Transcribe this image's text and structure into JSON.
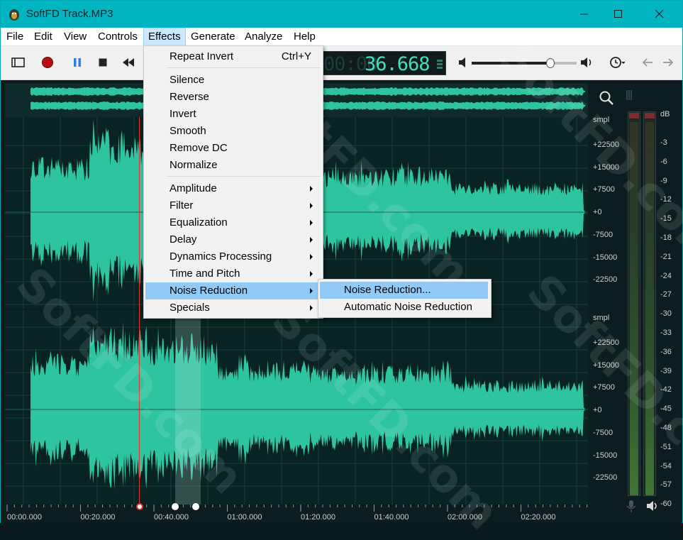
{
  "window": {
    "title": "SoftFD Track.MP3"
  },
  "menubar": [
    "File",
    "Edit",
    "View",
    "Controls",
    "Effects",
    "Generate",
    "Analyze",
    "Help"
  ],
  "effects_menu": {
    "items": [
      {
        "label": "Repeat Invert",
        "shortcut": "Ctrl+Y"
      },
      {
        "label": "Silence"
      },
      {
        "label": "Reverse"
      },
      {
        "label": "Invert"
      },
      {
        "label": "Smooth"
      },
      {
        "label": "Remove DC"
      },
      {
        "label": "Normalize"
      },
      {
        "label": "Amplitude",
        "submenu": true
      },
      {
        "label": "Filter",
        "submenu": true
      },
      {
        "label": "Equalization",
        "submenu": true
      },
      {
        "label": "Delay",
        "submenu": true
      },
      {
        "label": "Dynamics Processing",
        "submenu": true
      },
      {
        "label": "Time and Pitch",
        "submenu": true
      },
      {
        "label": "Noise Reduction",
        "submenu": true,
        "highlighted": true
      },
      {
        "label": "Specials",
        "submenu": true
      }
    ],
    "noise_reduction_submenu": [
      {
        "label": "Noise Reduction...",
        "highlighted": true
      },
      {
        "label": "Automatic Noise Reduction"
      }
    ]
  },
  "toolbar": {
    "time_dim": "00:00",
    "time_value": "36.668",
    "volume_level": 0.75,
    "icons": [
      "sidebar-toggle-icon",
      "record-icon",
      "pause-icon",
      "stop-icon",
      "rewind-icon",
      "speaker-low-icon",
      "speaker-high-icon",
      "clock-icon",
      "back-arrow-icon",
      "forward-arrow-icon"
    ]
  },
  "amplitude_axis": {
    "unit": "smpl",
    "labels": [
      "+22500",
      "+15000",
      "+7500",
      "+0",
      "-7500",
      "-15000",
      "-22500"
    ]
  },
  "meter": {
    "unit": "dB",
    "labels": [
      "-3",
      "-6",
      "-9",
      "-12",
      "-15",
      "-18",
      "-21",
      "-24",
      "-27",
      "-30",
      "-33",
      "-36",
      "-39",
      "-42",
      "-45",
      "-48",
      "-51",
      "-54",
      "-57",
      "-60"
    ]
  },
  "timeline": {
    "labels": [
      "00:00.000",
      "00:20.000",
      "00:40.000",
      "01:00.000",
      "01:20.000",
      "01:40.000",
      "02:00.000",
      "02:20.000"
    ]
  },
  "watermark": "SoftFD.com",
  "colors": {
    "titlebar": "#00b4c2",
    "waveform": "#2fc4a0",
    "menu_highlight": "#91c9f7",
    "time_digits": "#3fe0bf"
  }
}
